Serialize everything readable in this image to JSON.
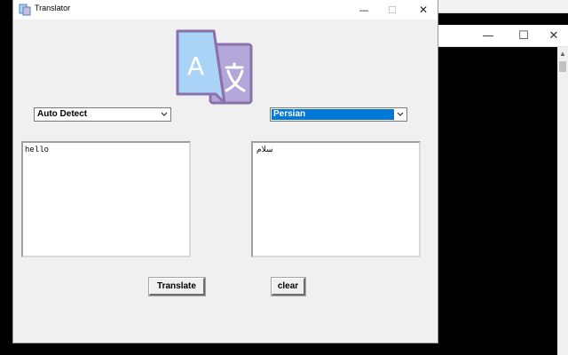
{
  "window": {
    "title": "Translator",
    "minimize_glyph": "—",
    "maximize_glyph": "☐",
    "close_glyph": "✕"
  },
  "background_window": {
    "minimize_glyph": "—",
    "maximize_glyph": "☐",
    "close_glyph": "✕"
  },
  "logo": {
    "icon": "translate-icon",
    "colors": {
      "page_light": "#a9d4f7",
      "page_back": "#b3a6d9",
      "stroke": "#8a70ad",
      "letter": "#ffffff"
    }
  },
  "source": {
    "language": "Auto Detect",
    "text": "hello"
  },
  "target": {
    "language": "Persian",
    "text": "سلام"
  },
  "buttons": {
    "translate_label": "Translate",
    "clear_label": "clear"
  },
  "colors": {
    "selection": "#0078d7",
    "window_bg": "#f0f0f0"
  }
}
